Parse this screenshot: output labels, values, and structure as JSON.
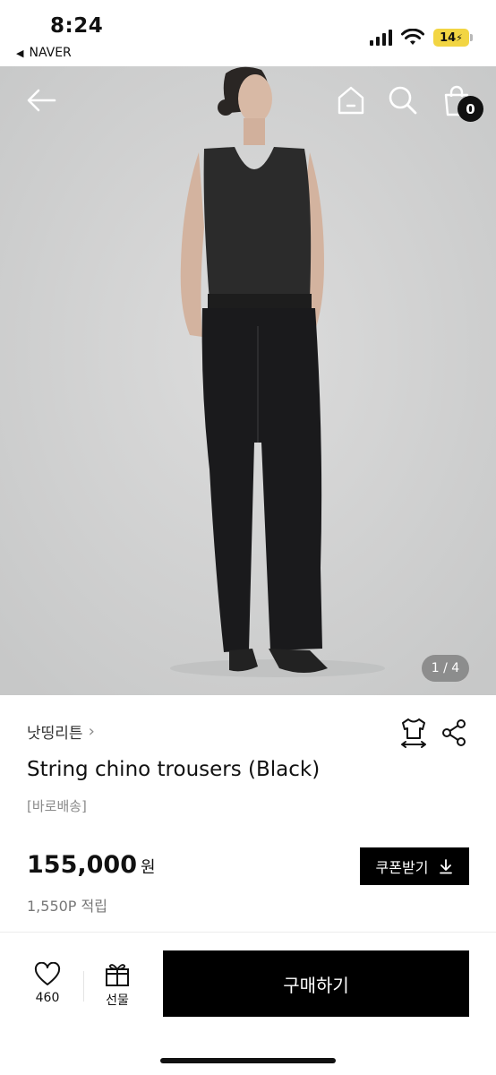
{
  "status_bar": {
    "time": "8:24",
    "back_app": "NAVER",
    "battery": "14"
  },
  "hero": {
    "page_indicator": "1 / 4",
    "cart_count": "0",
    "icons": [
      "back-arrow-icon",
      "home-icon",
      "search-icon",
      "shopping-bag-icon"
    ]
  },
  "product": {
    "brand": "낫띵리튼",
    "brand_chevron": "›",
    "title": "String chino trousers (Black)",
    "tag": "[바로배송]",
    "price": "155,000",
    "currency": "원",
    "points": "1,550P 적립",
    "coupon_label": "쿠폰받기"
  },
  "bottom_bar": {
    "like_count": "460",
    "gift_label": "선물",
    "buy_label": "구매하기"
  },
  "colors": {
    "primary_button": "#000000",
    "hero_background": "#d0d1d1",
    "battery": "#f2d543"
  }
}
